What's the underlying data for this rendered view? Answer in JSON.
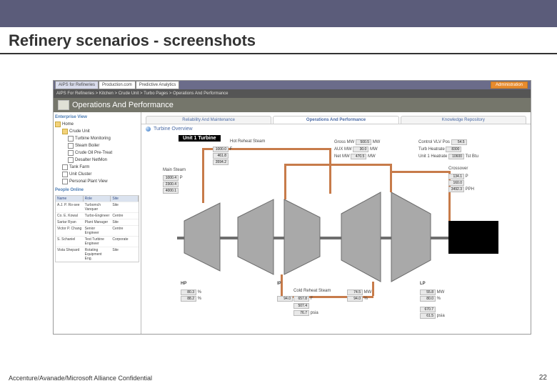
{
  "slide": {
    "title": "Refinery scenarios - screenshots",
    "footer": "Accenture/Avanade/Microsoft Alliance Confidential",
    "page_number": "22"
  },
  "app": {
    "tabs": [
      "AIPS for Refineries",
      "Production.com",
      "Predictive Analytics"
    ],
    "right_badge": "Administration",
    "breadcrumb": "AIPS For Refineries > Kitchen > Crude Unit > Turbo Pages > Operations And Performance",
    "page_title": "Operations And Performance"
  },
  "sidebar": {
    "header": "Enterprise View",
    "tree": [
      {
        "label": "Home"
      },
      {
        "label": "Crude Unit"
      },
      {
        "label": "Turbine Monitoring"
      },
      {
        "label": "Steam Boiler"
      },
      {
        "label": "Crude Oil Pre-Treat"
      },
      {
        "label": "Desalter NetMon"
      },
      {
        "label": "Tank Farm"
      },
      {
        "label": "Unit Cluster"
      },
      {
        "label": "Personal Plant View"
      }
    ],
    "people_online_header": "People Online",
    "people": {
      "cols": [
        "Name",
        "Role",
        "Site"
      ],
      "rows": [
        [
          "A.J. P. Ro-see",
          "Turbomch Vanquer",
          "Site"
        ],
        [
          "Co. E. Kowal",
          "Turbo-Engineer",
          "Centre"
        ],
        [
          "Sartar Ryan",
          "Plant Manager",
          "Site"
        ],
        [
          "Victor P. Chang",
          "Senior Engineer",
          "Centre"
        ],
        [
          "S. Schaniel",
          "Test Turbine Engineer",
          "Corporate"
        ],
        [
          "Vista Shepard",
          "Rotating Equipment Eng.",
          "Site"
        ]
      ]
    }
  },
  "main": {
    "tabs": [
      "Reliability And Maintenance",
      "Operations And Performance",
      "Knowledge Repository"
    ],
    "overview_title": "Turbine Overview",
    "unit_label": "Unit 1 Turbine",
    "labels": {
      "hot_reheat": "Hot Reheat Steam",
      "main_steam": "Main Steam",
      "gross_mw": "Gross MW",
      "aux_mw": "AUX MW",
      "net_mw": "Net MW",
      "ctrl_vlv": "Control VLV Pos",
      "turb_heatrate": "Turb Heatrate",
      "unit_heatrate": "Unit 1 Heatrate",
      "crossover": "Crossover",
      "hp": "HP",
      "ip": "IP",
      "lp": "LP",
      "cold_reheat": "Cold Reheat Steam",
      "tst_btu": "Tst Btu"
    },
    "units": {
      "F": "F",
      "P": "P",
      "MW": "MW",
      "PPH": "PPH",
      "pct": "%",
      "psia": "psia"
    },
    "values": {
      "hot_reheat": [
        "1000.0",
        "461.8",
        "3594.2"
      ],
      "main_steam": [
        "1000.4",
        "2300.4",
        "4000.1"
      ],
      "gross_mw": "500.5",
      "aux_mw": "30.0",
      "net_mw": "470.5",
      "ctrl_vlv": "54.5",
      "turb_heatrate": "8300",
      "unit_heatrate": "10600",
      "crossover": [
        "134.1",
        "160.0",
        "3492.3"
      ],
      "hp": [
        "80.3",
        "88.2"
      ],
      "ip": [
        "94.0"
      ],
      "ip2": [
        "74.5",
        "94.0"
      ],
      "cold_reheat": [
        "657.8",
        "507.4",
        "76.7"
      ],
      "lp": [
        "55.8",
        "80.0",
        "670.7",
        "61.5"
      ]
    }
  }
}
